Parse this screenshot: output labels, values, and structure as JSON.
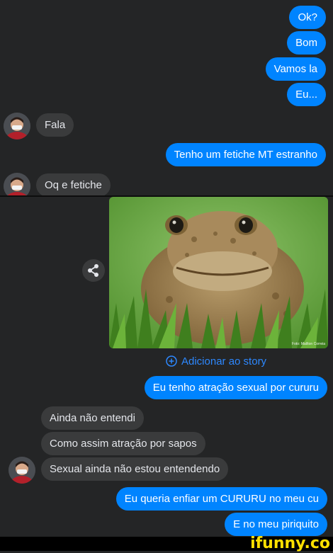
{
  "top_chat": {
    "messages": [
      {
        "side": "out",
        "text": "Ok?"
      },
      {
        "side": "out",
        "text": "Bom"
      },
      {
        "side": "out",
        "text": "Vamos la"
      },
      {
        "side": "out",
        "text": "Eu..."
      },
      {
        "side": "in",
        "text": "Fala"
      },
      {
        "side": "out",
        "text": "Tenho um fetiche MT estranho"
      },
      {
        "side": "in",
        "text": "Oq e fetiche"
      }
    ]
  },
  "bottom_chat": {
    "photo_credit": "Foto: Maílton Correia",
    "add_to_story": "Adicionar ao story",
    "messages": [
      {
        "side": "out",
        "text": "Eu tenho atração sexual por cururu"
      },
      {
        "side": "in",
        "text": "Ainda não  entendi"
      },
      {
        "side": "in",
        "text": "Como assim atração por sapos"
      },
      {
        "side": "in",
        "text": "Sexual ainda não  estou entendendo"
      },
      {
        "side": "out",
        "text": "Eu queria enfiar um CURURU no meu cu"
      },
      {
        "side": "out",
        "text": "E no meu piriquito"
      }
    ]
  },
  "watermark": "ifunny.co",
  "colors": {
    "background": "#242526",
    "outgoing_bubble": "#0084ff",
    "incoming_bubble": "#3a3b3c",
    "link": "#2d88ff",
    "watermark": "#ffe000"
  },
  "icons": [
    "avatar",
    "share-icon",
    "add-circle-icon",
    "toad-photo"
  ]
}
